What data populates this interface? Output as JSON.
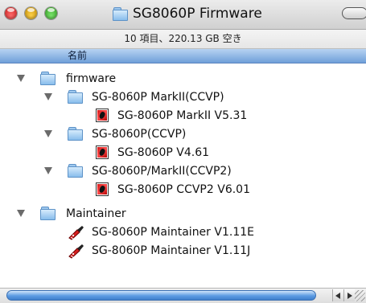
{
  "window": {
    "title": "SG8060P Firmware",
    "status_text": "10 項目、220.13 GB 空き"
  },
  "list": {
    "column_header": "名前",
    "rows": [
      {
        "label": "firmware",
        "type": "folder",
        "expanded": true
      },
      {
        "label": "SG-8060P MarkII(CCVP)",
        "type": "folder",
        "expanded": true
      },
      {
        "label": "SG-8060P MarkII V5.31",
        "type": "document"
      },
      {
        "label": "SG-8060P(CCVP)",
        "type": "folder",
        "expanded": true
      },
      {
        "label": "SG-8060P V4.61",
        "type": "document"
      },
      {
        "label": "SG-8060P/MarkII(CCVP2)",
        "type": "folder",
        "expanded": true
      },
      {
        "label": "SG-8060P CCVP2 V6.01",
        "type": "document"
      },
      {
        "label": "Maintainer",
        "type": "folder",
        "expanded": true
      },
      {
        "label": "SG-8060P Maintainer V1.11E",
        "type": "application"
      },
      {
        "label": "SG-8060P Maintainer V1.11J",
        "type": "application"
      }
    ]
  },
  "icons": {
    "close": "close-icon",
    "minimize": "minimize-icon",
    "zoom": "zoom-icon",
    "folder": "folder-icon",
    "document": "document-icon",
    "application": "application-icon",
    "disclosure": "disclosure-triangle-icon"
  },
  "colors": {
    "close": "#e03a3a",
    "minimize": "#e6a817",
    "zoom": "#4bbf3a",
    "header_selected": "#8db3e8",
    "folder": "#9ec8ee",
    "scroll_thumb": "#5c9be3"
  }
}
